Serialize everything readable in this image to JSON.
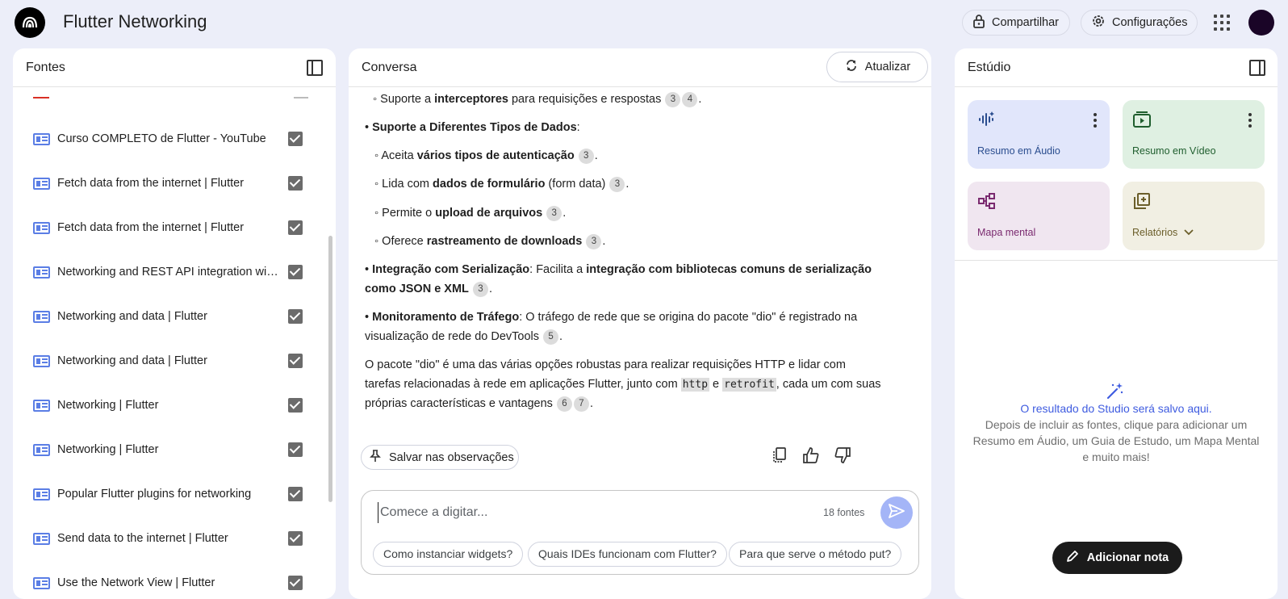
{
  "app": {
    "title": "Flutter Networking"
  },
  "header": {
    "share_label": "Compartilhar",
    "settings_label": "Configurações"
  },
  "sources": {
    "title": "Fontes",
    "items": [
      {
        "label": "Curso COMPLETO de Flutter - YouTube",
        "checked": true
      },
      {
        "label": "Fetch data from the internet | Flutter",
        "checked": true
      },
      {
        "label": "Fetch data from the internet | Flutter",
        "checked": true
      },
      {
        "label": "Networking and REST API integration with...",
        "checked": true
      },
      {
        "label": "Networking and data | Flutter",
        "checked": true
      },
      {
        "label": "Networking and data | Flutter",
        "checked": true
      },
      {
        "label": "Networking | Flutter",
        "checked": true
      },
      {
        "label": "Networking | Flutter",
        "checked": true
      },
      {
        "label": "Popular Flutter plugins for networking",
        "checked": true
      },
      {
        "label": "Send data to the internet | Flutter",
        "checked": true
      },
      {
        "label": "Use the Network View | Flutter",
        "checked": true
      }
    ]
  },
  "conversation": {
    "title": "Conversa",
    "refresh_label": "Atualizar",
    "content": {
      "l0": {
        "pre": "◦ Suporte a ",
        "b": "interceptores",
        "post": " para requisições e respostas",
        "c1": "3",
        "c2": "4",
        "end": "."
      },
      "l1": {
        "bullet": "• ",
        "b": "Suporte a Diferentes Tipos de Dados",
        "post": ":"
      },
      "l2": {
        "pre": "◦ Aceita ",
        "b": "vários tipos de autenticação",
        "c": "3",
        "end": "."
      },
      "l3": {
        "pre": "◦ Lida com ",
        "b": "dados de formulário",
        "post": " (form data) ",
        "c": "3",
        "end": "."
      },
      "l4": {
        "pre": "◦ Permite o ",
        "b": "upload de arquivos",
        "c": "3",
        "end": "."
      },
      "l5": {
        "pre": "◦ Oferece ",
        "b": "rastreamento de downloads",
        "c": "3",
        "end": "."
      },
      "l6": {
        "bullet": "• ",
        "b1": "Integração com Serialização",
        "mid": ": Facilita a ",
        "b2": "integração com bibliotecas comuns de serialização",
        "b3": "como JSON e XML",
        "c": "3",
        "end": "."
      },
      "l7": {
        "bullet": "• ",
        "b": "Monitoramento de Tráfego",
        "post": ": O tráfego de rede que se origina do pacote \"dio\" é registrado na",
        "post2": "visualização de rede do DevTools",
        "c": "5",
        "end": "."
      },
      "l8": {
        "t1": "O pacote \"dio\" é uma das várias opções robustas para realizar requisições HTTP e lidar com",
        "t2": "tarefas relacionadas à rede em aplicações Flutter, junto com ",
        "code1": "http",
        "and": " e ",
        "code2": "retrofit",
        "t3": ", cada um com suas",
        "t4": "próprias características e vantagens",
        "c1": "6",
        "c2": "7",
        "end": "."
      }
    },
    "save_notes_label": "Salvar nas observações",
    "composer": {
      "placeholder": "Comece a digitar...",
      "source_count": "18 fontes"
    },
    "suggestions": [
      "Como instanciar widgets?",
      "Quais IDEs funcionam com Flutter?",
      "Para que serve o método put?"
    ]
  },
  "studio": {
    "title": "Estúdio",
    "tiles": [
      {
        "label": "Resumo em Áudio",
        "bg": "#e1e6fb",
        "fg": "#2a4d8f"
      },
      {
        "label": "Resumo em Vídeo",
        "bg": "#dff0e2",
        "fg": "#1f5e2e"
      },
      {
        "label": "Mapa mental",
        "bg": "#f0e6f0",
        "fg": "#7a2a6f"
      },
      {
        "label": "Relatórios",
        "bg": "#f1efe3",
        "fg": "#6b5e2a"
      }
    ],
    "empty_title": "O resultado do Studio será salvo aqui.",
    "empty_desc": "Depois de incluir as fontes, clique para adicionar um Resumo em Áudio, um Guia de Estudo, um Mapa Mental e muito mais!",
    "add_note_label": "Adicionar nota"
  },
  "colors": {
    "accent": "#3f5ce0",
    "page_bg": "#eceef9",
    "send_btn": "#a4b5f7"
  }
}
